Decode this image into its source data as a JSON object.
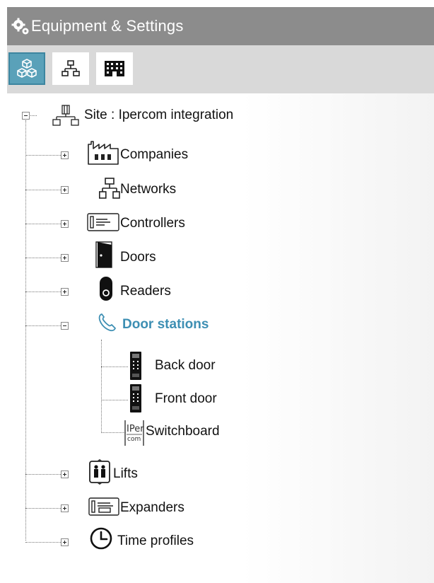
{
  "header": {
    "title": "Equipment & Settings",
    "icon": "gears-icon"
  },
  "toolbar": {
    "buttons": [
      {
        "name": "cubes-view",
        "icon": "cubes-icon",
        "active": true
      },
      {
        "name": "hierarchy-view",
        "icon": "network-icon",
        "active": false
      },
      {
        "name": "building-view",
        "icon": "building-icon",
        "active": false
      }
    ]
  },
  "tree": {
    "root": {
      "label": "Site : Ipercom integration",
      "icon": "site-icon",
      "expanded": true
    },
    "items": [
      {
        "label": "Companies",
        "icon": "factory-icon",
        "expanded": false
      },
      {
        "label": "Networks",
        "icon": "network-icon",
        "expanded": false
      },
      {
        "label": "Controllers",
        "icon": "controller-icon",
        "expanded": false
      },
      {
        "label": "Doors",
        "icon": "door-icon",
        "expanded": false
      },
      {
        "label": "Readers",
        "icon": "reader-icon",
        "expanded": false
      },
      {
        "label": "Door stations",
        "icon": "phone-icon",
        "expanded": true,
        "selected": true,
        "children": [
          {
            "label": "Back door",
            "icon": "intercom-icon"
          },
          {
            "label": "Front door",
            "icon": "intercom-icon"
          },
          {
            "label": "Switchboard",
            "icon": "ipercom-logo-icon"
          }
        ]
      },
      {
        "label": "Lifts",
        "icon": "lift-icon",
        "expanded": false
      },
      {
        "label": "Expanders",
        "icon": "expander-icon",
        "expanded": false
      },
      {
        "label": "Time profiles",
        "icon": "clock-icon",
        "expanded": false
      }
    ]
  },
  "colors": {
    "titlebar": "#8c8c8c",
    "toolbar": "#d9d9d9",
    "accent": "#5aa1b9",
    "selected_text": "#3d8fb3"
  }
}
